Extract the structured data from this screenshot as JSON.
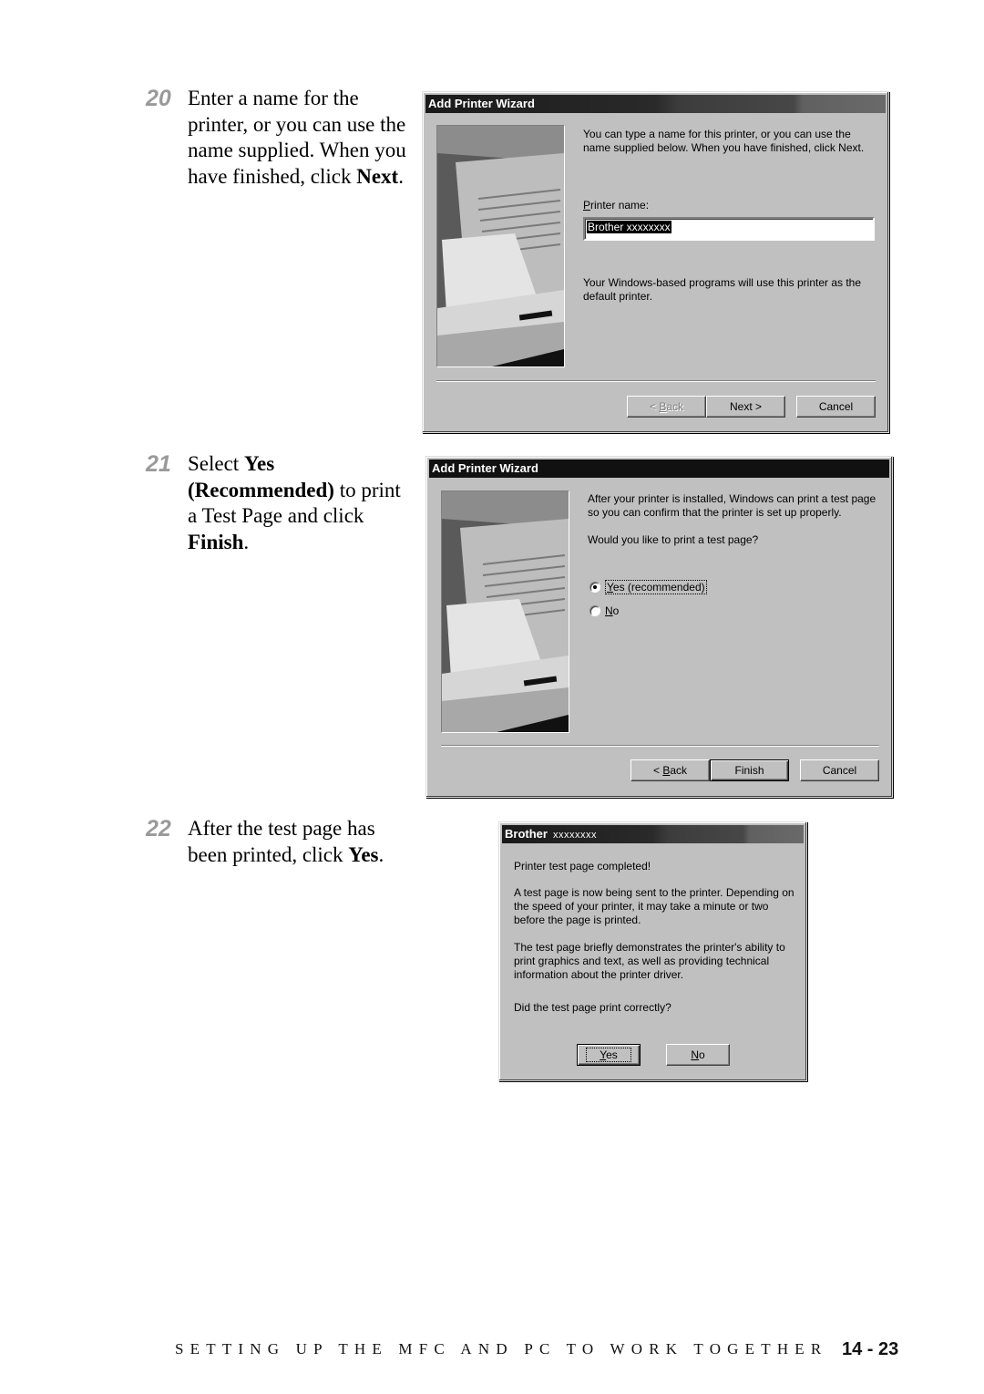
{
  "steps": [
    {
      "number": "20",
      "parts": [
        {
          "text": "Enter a name for the printer,  or you can use the name supplied. When you have finished, click ",
          "bold": false
        },
        {
          "text": "Next",
          "bold": true
        },
        {
          "text": ".",
          "bold": false
        }
      ]
    },
    {
      "number": "21",
      "parts": [
        {
          "text": "Select ",
          "bold": false
        },
        {
          "text": "Yes (Recommended)",
          "bold": true
        },
        {
          "text": " to print  a Test Page and click ",
          "bold": false
        },
        {
          "text": "Finish",
          "bold": true
        },
        {
          "text": ".",
          "bold": false
        }
      ]
    },
    {
      "number": "22",
      "parts": [
        {
          "text": "After the test page has been printed, click ",
          "bold": false
        },
        {
          "text": "Yes",
          "bold": true
        },
        {
          "text": ".",
          "bold": false
        }
      ]
    }
  ],
  "dialog1": {
    "title": "Add Printer Wizard",
    "intro": "You can type a name for this printer, or you can use the name supplied below. When you have finished, click Next.",
    "printer_name_label_mnemonic": "P",
    "printer_name_label_rest": "rinter name:",
    "printer_name_value": "Brother  xxxxxxxx",
    "default_note": "Your Windows-based programs will use this printer as the default printer.",
    "buttons": {
      "back_prefix": "< ",
      "back_mnemonic": "B",
      "back_rest": "ack",
      "next": "Next >",
      "cancel": "Cancel"
    }
  },
  "dialog2": {
    "title": "Add Printer Wizard",
    "intro": "After your printer is installed, Windows can print a test page so you can confirm that the printer is set up properly.",
    "question": "Would you like to print a test page?",
    "options": [
      {
        "mnemonic": "Y",
        "rest": "es (recommended)",
        "selected": true
      },
      {
        "mnemonic": "N",
        "rest": "o",
        "selected": false
      }
    ],
    "buttons": {
      "back_prefix": "< ",
      "back_mnemonic": "B",
      "back_rest": "ack",
      "finish": "Finish",
      "cancel": "Cancel"
    }
  },
  "dialog3": {
    "title_bold": "Brother",
    "title_rest": "xxxxxxxx",
    "heading": "Printer test page completed!",
    "para1": "A test page is now being sent to the printer. Depending on the speed of your printer, it may take a minute or two before the page is printed.",
    "para2": "The test page briefly demonstrates the printer's ability to print graphics and text, as well as providing technical information about the printer driver.",
    "question": "Did the test page print correctly?",
    "buttons": {
      "yes_mnemonic": "Y",
      "yes_rest": "es",
      "no_mnemonic": "N",
      "no_rest": "o"
    }
  },
  "footer": {
    "chapter_title": "SETTING UP THE MFC AND PC TO WORK TOGETHER",
    "page_number": "14 - 23"
  }
}
